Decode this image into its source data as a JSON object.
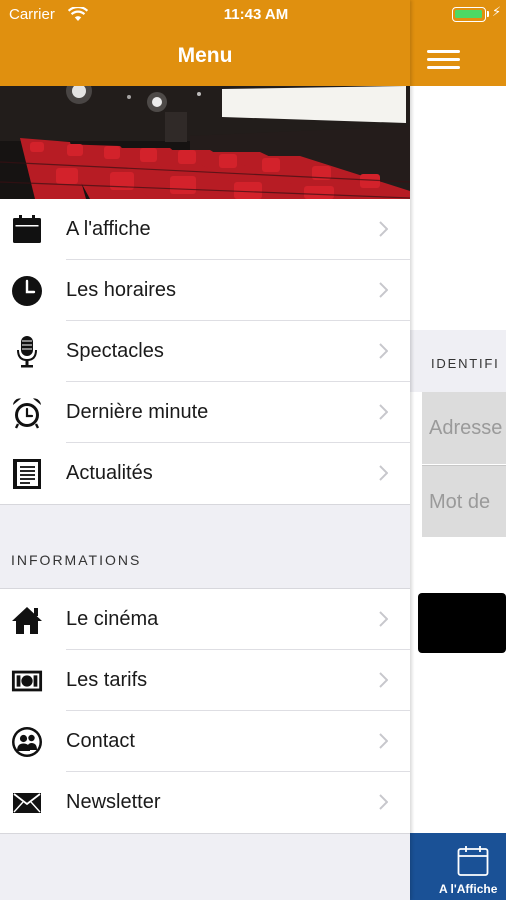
{
  "status_bar": {
    "carrier": "Carrier",
    "time": "11:43 AM",
    "battery_color": "#4cd964",
    "icons": [
      "wifi-icon",
      "battery-icon",
      "charging-icon"
    ]
  },
  "drawer": {
    "title": "Menu",
    "header_color": "#e0900f",
    "main_items": [
      {
        "label": "A l'affiche",
        "icon": "calendar-icon"
      },
      {
        "label": "Les horaires",
        "icon": "clock-icon"
      },
      {
        "label": "Spectacles",
        "icon": "microphone-icon"
      },
      {
        "label": "Dernière minute",
        "icon": "alarm-clock-icon"
      },
      {
        "label": "Actualités",
        "icon": "newspaper-icon"
      }
    ],
    "info_section_title": "INFORMATIONS",
    "info_items": [
      {
        "label": "Le cinéma",
        "icon": "home-icon"
      },
      {
        "label": "Les tarifs",
        "icon": "banknote-icon"
      },
      {
        "label": "Contact",
        "icon": "contacts-icon"
      },
      {
        "label": "Newsletter",
        "icon": "envelope-icon"
      }
    ]
  },
  "behind_screen": {
    "section_title": "IDENTIFI",
    "email_placeholder": "Adresse",
    "password_placeholder": "Mot de",
    "tab_label": "A l'Affiche",
    "tab_bar_color": "#1a5196"
  }
}
